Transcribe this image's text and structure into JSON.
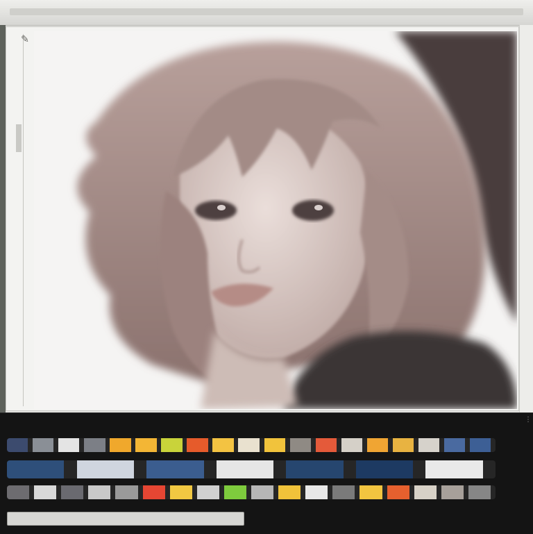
{
  "window": {
    "canvas_corner_icon": "pen-tablet-icon",
    "canvas_status": "",
    "panel_title": "",
    "timeline_start": "",
    "timeline_value": ""
  },
  "colors": {
    "panel_bg": "#141414",
    "canvas_bg": "#f3f3f1",
    "hair": "#9b8480",
    "skin": "#d9c9c4",
    "cap": "#4a3e3c",
    "jacket": "#3b3534"
  },
  "swatch_rows": [
    [
      "#3c4b6e",
      "#8a8f96",
      "#e4e4e4",
      "#7c7f86",
      "#f0a82c",
      "#f3b635",
      "#c9d33a",
      "#e65b2b",
      "#f3c342",
      "#e9e1cf",
      "#f1c33c",
      "#8f8a84",
      "#e45a3a",
      "#d5d0c8",
      "#f0a533",
      "#e8b341",
      "#d6d2cb",
      "#4a6aa0",
      "#3d5f95"
    ],
    [
      "#2e4f7a",
      "#cfd5df",
      "#3b5d8f",
      "#e6e6e6",
      "#26466f",
      "#1d3a62",
      "#e9e9e9"
    ],
    [
      "#6d6c70",
      "#d8d8d8",
      "#6a6a70",
      "#c9c9c9",
      "#9a9a9a",
      "#e64633",
      "#f1c842",
      "#d0d0d0",
      "#7ecb3d",
      "#b6b6b6",
      "#f0c23a",
      "#e8e8e8",
      "#7a7a7a",
      "#f2c540",
      "#e6602e",
      "#d7d1c7",
      "#a7a09a",
      "#868686"
    ]
  ]
}
